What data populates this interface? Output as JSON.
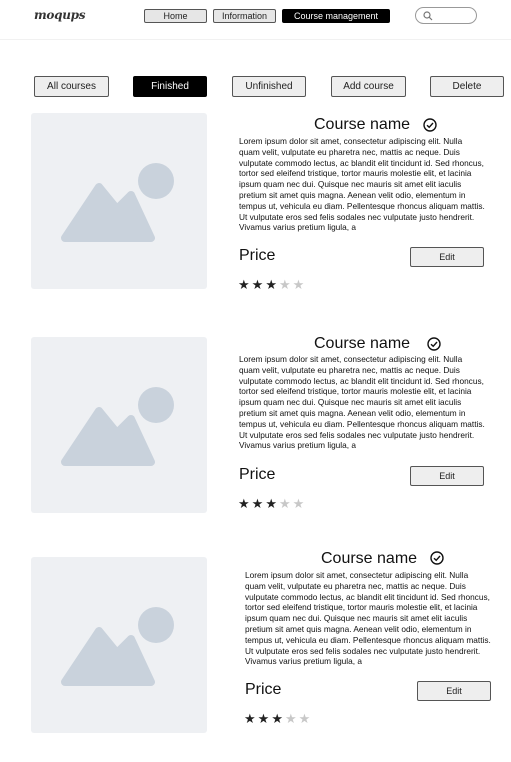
{
  "app": {
    "logo": "moqups"
  },
  "nav": {
    "items": [
      {
        "label": "Home"
      },
      {
        "label": "Information"
      },
      {
        "label": "Course management"
      }
    ],
    "search_placeholder": ""
  },
  "filters": [
    {
      "label": "All courses"
    },
    {
      "label": "Finished"
    },
    {
      "label": "Unfinished"
    },
    {
      "label": "Add course"
    },
    {
      "label": "Delete"
    }
  ],
  "courses": [
    {
      "title": "Course name",
      "description": "Lorem ipsum dolor sit amet, consectetur adipiscing elit. Nulla quam velit, vulputate eu pharetra nec, mattis ac neque. Duis vulputate commodo lectus, ac blandit elit tincidunt id. Sed rhoncus, tortor sed eleifend tristique, tortor mauris molestie elit, et lacinia ipsum quam nec dui. Quisque nec mauris sit amet elit iaculis pretium sit amet quis magna. Aenean velit odio, elementum in tempus ut, vehicula eu diam. Pellentesque rhoncus aliquam mattis. Ut vulputate eros sed felis sodales nec vulputate justo hendrerit. Vivamus varius pretium ligula, a",
      "price_label": "Price",
      "edit_label": "Edit",
      "rating": 3,
      "rating_max": 5
    },
    {
      "title": "Course name",
      "description": "Lorem ipsum dolor sit amet, consectetur adipiscing elit. Nulla quam velit, vulputate eu pharetra nec, mattis ac neque. Duis vulputate commodo lectus, ac blandit elit tincidunt id. Sed rhoncus, tortor sed eleifend tristique, tortor mauris molestie elit, et lacinia ipsum quam nec dui. Quisque nec mauris sit amet elit iaculis pretium sit amet quis magna. Aenean velit odio, elementum in tempus ut, vehicula eu diam. Pellentesque rhoncus aliquam mattis. Ut vulputate eros sed felis sodales nec vulputate justo hendrerit. Vivamus varius pretium ligula, a",
      "price_label": "Price",
      "edit_label": "Edit",
      "rating": 3,
      "rating_max": 5
    },
    {
      "title": "Course name",
      "description": "Lorem ipsum dolor sit amet, consectetur adipiscing elit. Nulla quam velit, vulputate eu pharetra nec, mattis ac neque. Duis vulputate commodo lectus, ac blandit elit tincidunt id. Sed rhoncus, tortor sed eleifend tristique, tortor mauris molestie elit, et lacinia ipsum quam nec dui. Quisque nec mauris sit amet elit iaculis pretium sit amet quis magna. Aenean velit odio, elementum in tempus ut, vehicula eu diam. Pellentesque rhoncus aliquam mattis. Ut vulputate eros sed felis sodales nec vulputate justo hendrerit. Vivamus varius pretium ligula, a",
      "price_label": "Price",
      "edit_label": "Edit",
      "rating": 3,
      "rating_max": 5
    }
  ]
}
